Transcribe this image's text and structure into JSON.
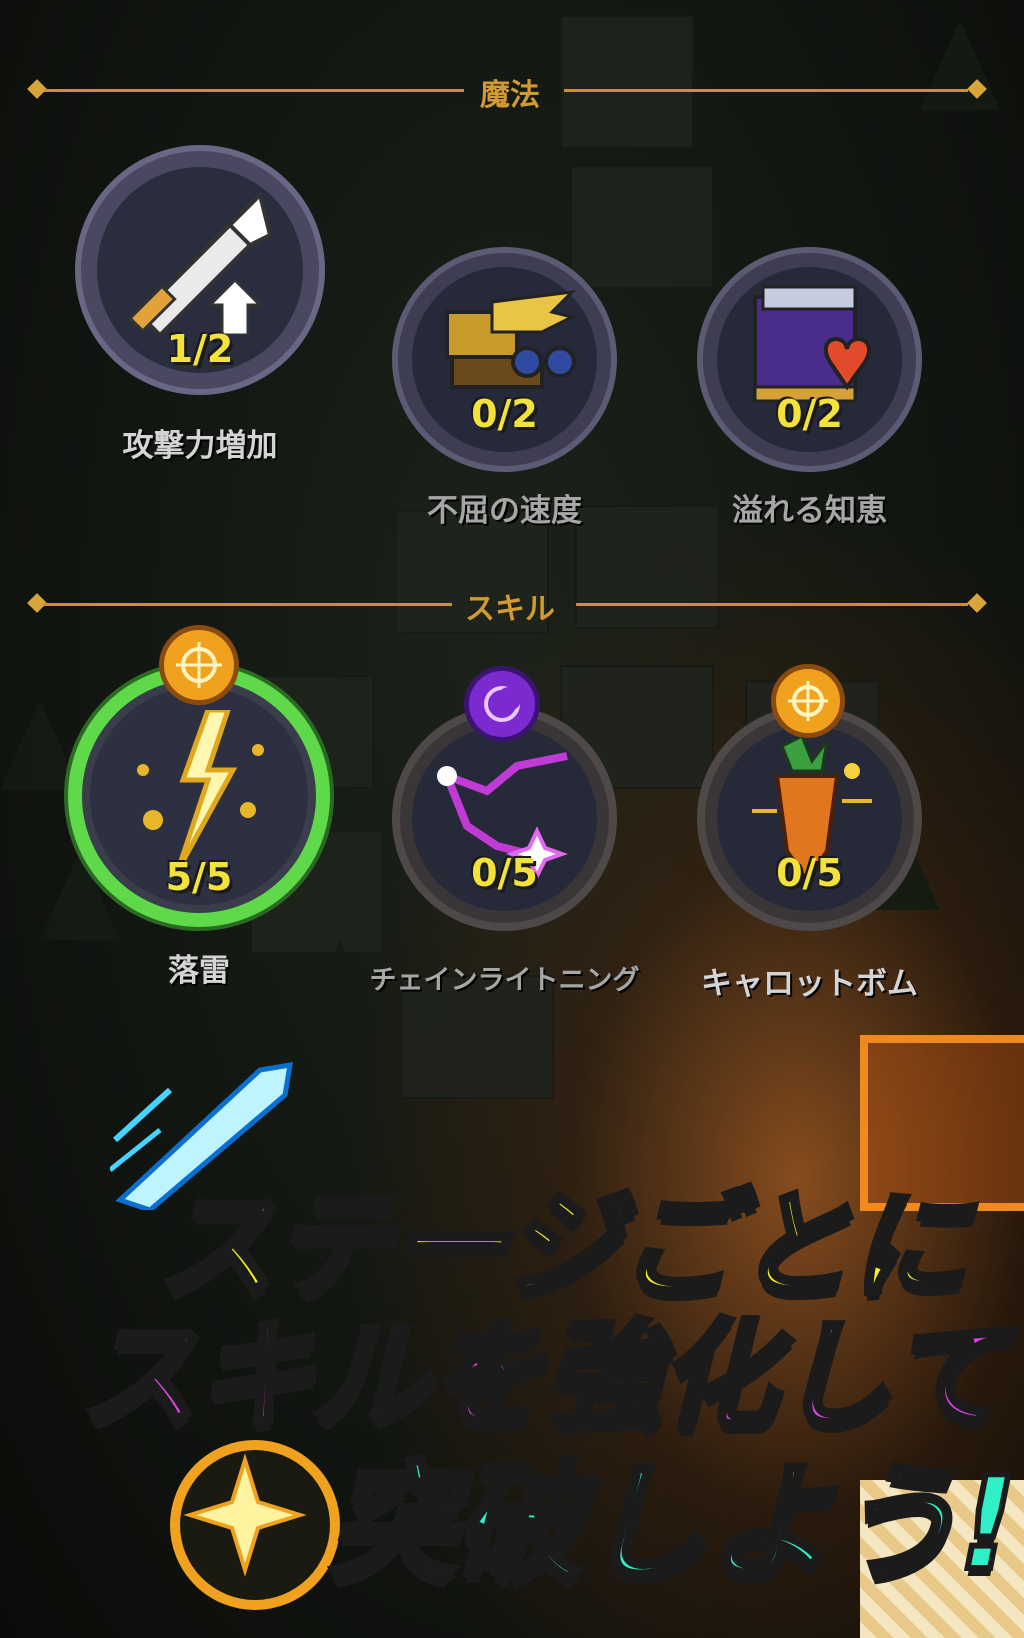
{
  "sections": {
    "magic_title": "魔法",
    "skill_title": "スキル"
  },
  "magic": [
    {
      "name": "攻撃力増加",
      "level": "1/2",
      "icon": "sword-arrow-icon"
    },
    {
      "name": "不屈の速度",
      "level": "0/2",
      "icon": "winged-boots-icon"
    },
    {
      "name": "溢れる知恵",
      "level": "0/2",
      "icon": "book-heart-icon"
    }
  ],
  "skills": [
    {
      "name": "落雷",
      "level": "5/5",
      "icon": "lightning-icon",
      "badge": "sun-badge-icon"
    },
    {
      "name": "チェインライトニング",
      "level": "0/5",
      "icon": "chain-lightning-icon",
      "badge": "moon-badge-icon"
    },
    {
      "name": "キャロットボム",
      "level": "0/5",
      "icon": "carrot-bomb-icon",
      "badge": "sun-badge-icon"
    }
  ],
  "promo": {
    "line1": "ステージごとに",
    "line2": "スキルを強化して",
    "line3": "突破しよう!"
  },
  "colors": {
    "gold": "#d39a2f",
    "level_yellow": "#f2e23a",
    "active_ring": "#5fd94a",
    "promo_yellow": "#f7f023",
    "promo_magenta": "#e044e6",
    "promo_teal": "#2ff0c6"
  }
}
